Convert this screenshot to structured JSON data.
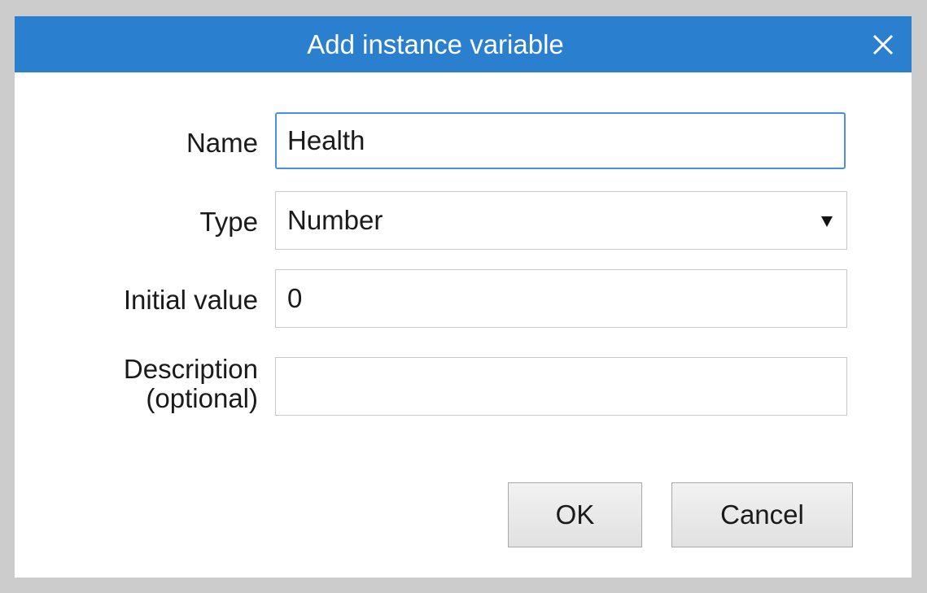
{
  "dialog": {
    "title": "Add instance variable",
    "close_icon": "close-icon"
  },
  "form": {
    "name_label": "Name",
    "name_value": "Health",
    "type_label": "Type",
    "type_value": "Number",
    "type_arrow_icon": "dropdown-arrow-icon",
    "initial_label": "Initial value",
    "initial_value": "0",
    "description_label_line1": "Description",
    "description_label_line2": "(optional)",
    "description_value": ""
  },
  "buttons": {
    "ok_label": "OK",
    "cancel_label": "Cancel"
  },
  "colors": {
    "titlebar": "#2b7fcf",
    "focus_border": "#4a90e2",
    "backdrop": "#cccccc"
  }
}
